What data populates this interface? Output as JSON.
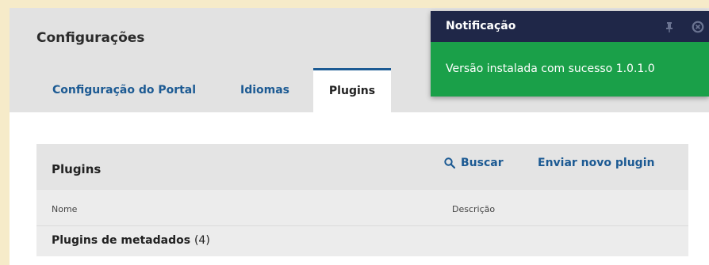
{
  "header": {
    "title": "Configurações",
    "tabs": [
      {
        "label": "Configuração do Portal",
        "active": false
      },
      {
        "label": "Idiomas",
        "active": false
      },
      {
        "label": "Plugins",
        "active": true
      }
    ]
  },
  "plugins_panel": {
    "title": "Plugins",
    "search_label": "Buscar",
    "upload_label": "Enviar novo plugin",
    "columns": [
      "Nome",
      "Descrição"
    ],
    "group": {
      "name": "Plugins de metadados",
      "count": "(4)"
    }
  },
  "notification": {
    "title": "Notificação",
    "message": "Versão instalada com sucesso 1.0.1.0",
    "icons": [
      "pin-icon",
      "close-icon"
    ],
    "colors": {
      "header": "#1f2748",
      "body": "#1aa049"
    }
  },
  "colors": {
    "link": "#1c5a93",
    "background": "#f6ebc9"
  }
}
